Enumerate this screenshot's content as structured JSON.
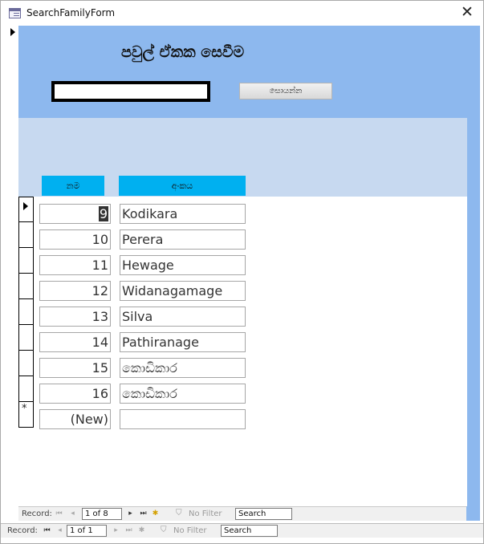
{
  "window": {
    "title": "SearchFamilyForm",
    "close_glyph": "✕"
  },
  "header": {
    "title": "පවුල් ඒකක සෙවීම",
    "search_value": "",
    "search_button": "සොයන්න"
  },
  "columns": {
    "id": "නම",
    "name": "අංකය"
  },
  "rows": [
    {
      "id": "9",
      "name": "Kodikara",
      "current": true
    },
    {
      "id": "10",
      "name": "Perera"
    },
    {
      "id": "11",
      "name": "Hewage"
    },
    {
      "id": "12",
      "name": "Widanagamage"
    },
    {
      "id": "13",
      "name": "Silva"
    },
    {
      "id": "14",
      "name": "Pathiranage"
    },
    {
      "id": "15",
      "name": "කොඩිකාර"
    },
    {
      "id": "16",
      "name": "කොඩිකාර"
    }
  ],
  "new_row": {
    "selector": "*",
    "id": "(New)",
    "name": ""
  },
  "subform_nav": {
    "label": "Record:",
    "position": "1 of 8",
    "filter": "No Filter",
    "search": "Search"
  },
  "main_nav": {
    "label": "Record:",
    "position": "1 of 1",
    "filter": "No Filter",
    "search": "Search"
  },
  "colors": {
    "header_bg": "#8db8ee",
    "subheader_bg": "#c7d9f0",
    "column_header_bg": "#00b0f0"
  },
  "icons": {
    "first": "first-record-icon",
    "prev": "previous-record-icon",
    "next": "next-record-icon",
    "last": "last-record-icon",
    "new": "new-record-icon",
    "filter": "filter-off-icon"
  }
}
